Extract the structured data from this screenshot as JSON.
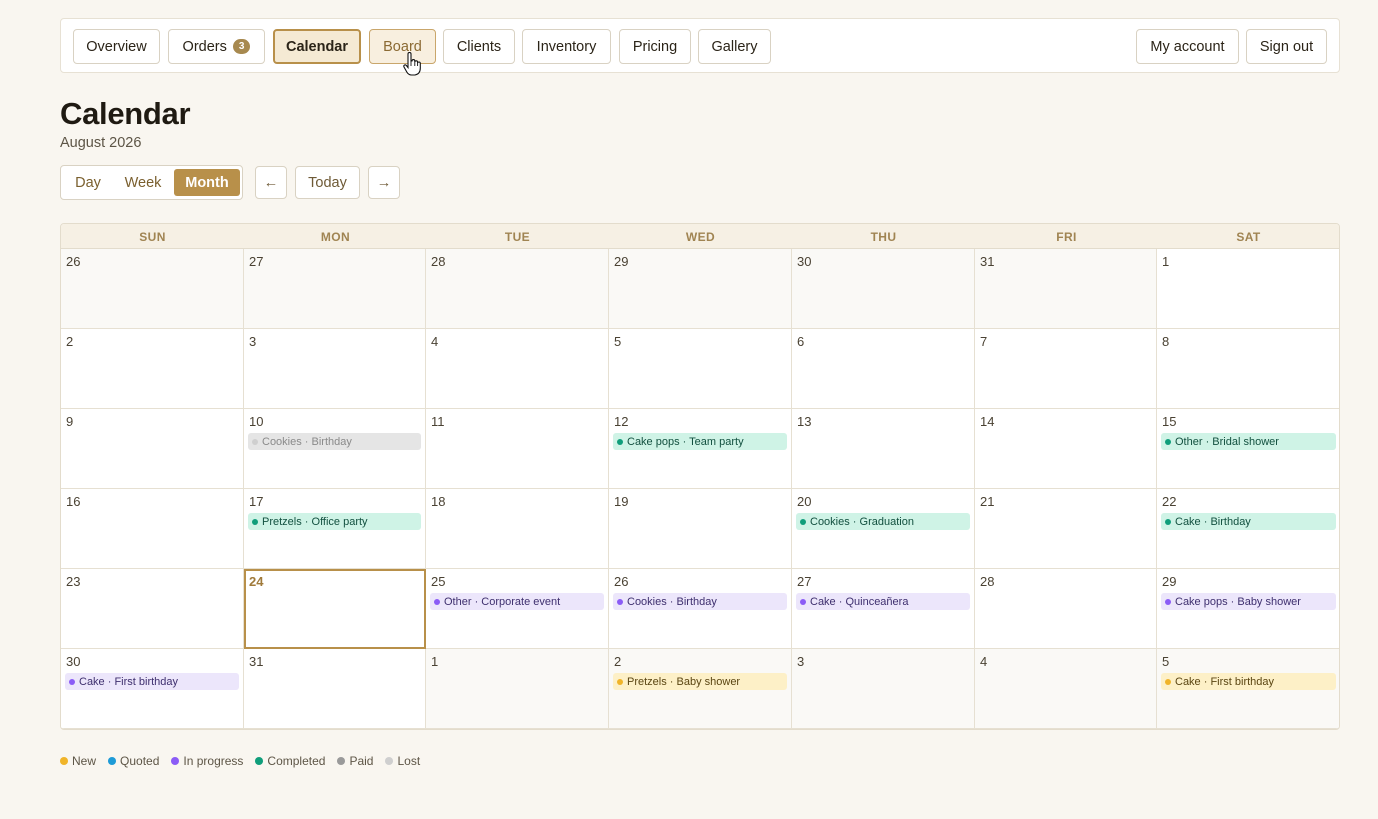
{
  "nav": {
    "items": [
      {
        "label": "Overview"
      },
      {
        "label": "Orders",
        "badge": "3"
      },
      {
        "label": "Calendar"
      },
      {
        "label": "Board"
      },
      {
        "label": "Clients"
      },
      {
        "label": "Inventory"
      },
      {
        "label": "Pricing"
      },
      {
        "label": "Gallery"
      }
    ],
    "active": "Calendar",
    "hovered": "Board",
    "account_label": "My account",
    "signout_label": "Sign out"
  },
  "page": {
    "title": "Calendar",
    "subtitle": "August 2026"
  },
  "view_switch": {
    "options": [
      "Day",
      "Week",
      "Month"
    ],
    "selected": "Month"
  },
  "controls": {
    "prev": "←",
    "today": "Today",
    "next": "→"
  },
  "calendar": {
    "weekdays": [
      "SUN",
      "MON",
      "TUE",
      "WED",
      "THU",
      "FRI",
      "SAT"
    ],
    "weeks": [
      [
        {
          "day": "26",
          "out": true
        },
        {
          "day": "27",
          "out": true
        },
        {
          "day": "28",
          "out": true
        },
        {
          "day": "29",
          "out": true
        },
        {
          "day": "30",
          "out": true
        },
        {
          "day": "31",
          "out": true
        },
        {
          "day": "1"
        }
      ],
      [
        {
          "day": "2"
        },
        {
          "day": "3"
        },
        {
          "day": "4"
        },
        {
          "day": "5"
        },
        {
          "day": "6"
        },
        {
          "day": "7"
        },
        {
          "day": "8"
        }
      ],
      [
        {
          "day": "9"
        },
        {
          "day": "10",
          "event": {
            "text": "Cookies · Birthday",
            "status": "lost"
          }
        },
        {
          "day": "11"
        },
        {
          "day": "12",
          "event": {
            "text": "Cake pops · Team party",
            "status": "completed"
          }
        },
        {
          "day": "13"
        },
        {
          "day": "14"
        },
        {
          "day": "15",
          "event": {
            "text": "Other · Bridal shower",
            "status": "completed"
          }
        }
      ],
      [
        {
          "day": "16"
        },
        {
          "day": "17",
          "event": {
            "text": "Pretzels · Office party",
            "status": "completed"
          }
        },
        {
          "day": "18"
        },
        {
          "day": "19"
        },
        {
          "day": "20",
          "event": {
            "text": "Cookies · Graduation",
            "status": "completed"
          }
        },
        {
          "day": "21"
        },
        {
          "day": "22",
          "event": {
            "text": "Cake · Birthday",
            "status": "completed"
          }
        }
      ],
      [
        {
          "day": "23"
        },
        {
          "day": "24",
          "today": true
        },
        {
          "day": "25",
          "event": {
            "text": "Other · Corporate event",
            "status": "in_progress"
          }
        },
        {
          "day": "26",
          "event": {
            "text": "Cookies · Birthday",
            "status": "in_progress"
          }
        },
        {
          "day": "27",
          "event": {
            "text": "Cake · Quinceañera",
            "status": "in_progress"
          }
        },
        {
          "day": "28"
        },
        {
          "day": "29",
          "event": {
            "text": "Cake pops · Baby shower",
            "status": "in_progress"
          }
        }
      ],
      [
        {
          "day": "30",
          "event": {
            "text": "Cake · First birthday",
            "status": "in_progress"
          }
        },
        {
          "day": "31"
        },
        {
          "day": "1",
          "out": true
        },
        {
          "day": "2",
          "out": true,
          "event": {
            "text": "Pretzels · Baby shower",
            "status": "new"
          }
        },
        {
          "day": "3",
          "out": true
        },
        {
          "day": "4",
          "out": true
        },
        {
          "day": "5",
          "out": true,
          "event": {
            "text": "Cake · First birthday",
            "status": "new"
          }
        }
      ]
    ]
  },
  "status_colors": {
    "new": {
      "dot": "#f0b429",
      "bg": "#fdf0c7",
      "text": "#5a4512"
    },
    "quoted": {
      "dot": "#1e9bd7",
      "bg": "#d9f0fb",
      "text": "#1d4a63"
    },
    "in_progress": {
      "dot": "#8b5cf6",
      "bg": "#ece6fb",
      "text": "#3e2f6e"
    },
    "completed": {
      "dot": "#109e7b",
      "bg": "#cff3e6",
      "text": "#12503f"
    },
    "paid": {
      "dot": "#9a9a9a",
      "bg": "#ececec",
      "text": "#4a4a4a"
    },
    "lost": {
      "dot": "#cfcfcf",
      "bg": "#e5e5e5",
      "text": "#8a8a8a"
    }
  },
  "legend": [
    {
      "label": "New",
      "status": "new"
    },
    {
      "label": "Quoted",
      "status": "quoted"
    },
    {
      "label": "In progress",
      "status": "in_progress"
    },
    {
      "label": "Completed",
      "status": "completed"
    },
    {
      "label": "Paid",
      "status": "paid"
    },
    {
      "label": "Lost",
      "status": "lost"
    }
  ]
}
